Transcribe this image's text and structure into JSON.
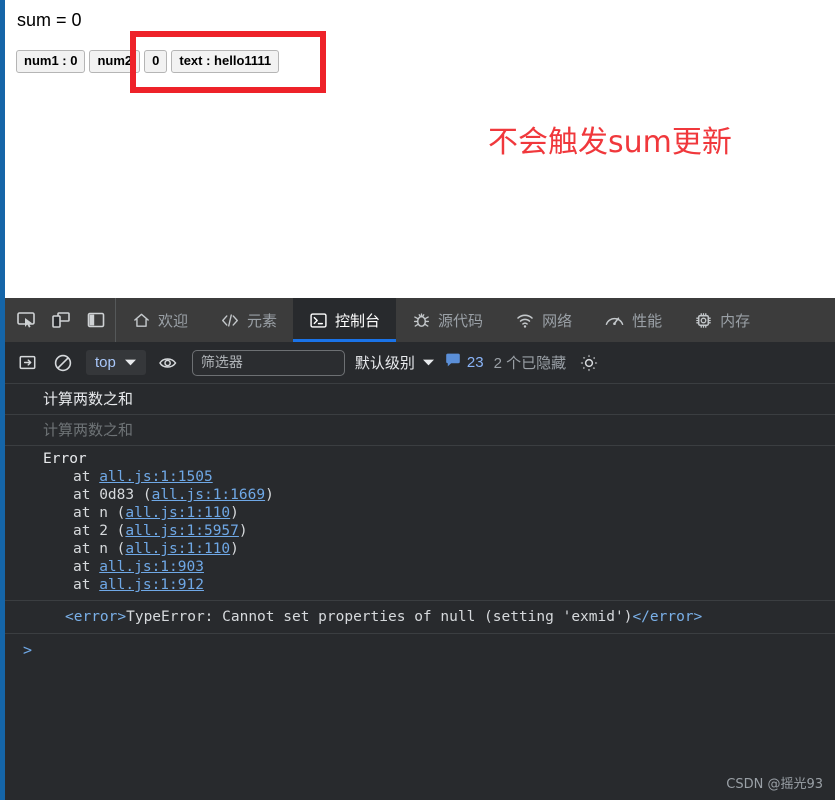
{
  "page": {
    "sum_text": "sum = 0",
    "buttons": [
      {
        "label": "num1 : 0",
        "name": "num1-button"
      },
      {
        "label": "num2",
        "name": "num2-button"
      },
      {
        "label": "0",
        "name": "num2-value-button"
      },
      {
        "label": "text : hello1111",
        "name": "text-button"
      }
    ],
    "annotation": "不会触发sum更新",
    "annotation_color": "#f0383c",
    "highlight_color": "#ee2229"
  },
  "devtools": {
    "tool_icons": [
      {
        "name": "inspect-element-icon"
      },
      {
        "name": "device-toolbar-icon"
      },
      {
        "name": "dock-side-icon"
      }
    ],
    "tabs": [
      {
        "label": "欢迎",
        "icon": "home-icon",
        "active": false
      },
      {
        "label": "元素",
        "icon": "code-brackets-icon",
        "active": false
      },
      {
        "label": "控制台",
        "icon": "console-terminal-icon",
        "active": true
      },
      {
        "label": "源代码",
        "icon": "bug-icon",
        "active": false
      },
      {
        "label": "网络",
        "icon": "network-wifi-icon",
        "active": false
      },
      {
        "label": "性能",
        "icon": "performance-gauge-icon",
        "active": false
      },
      {
        "label": "内存",
        "icon": "memory-chip-icon",
        "active": false
      }
    ],
    "active_tab_accent": "#1a73e8",
    "toolbar": {
      "sidebar_toggle": "console-sidebar-icon",
      "clear_label": "clear-console-icon",
      "context": "top",
      "eye_icon": "live-expression-icon",
      "filter_placeholder": "筛选器",
      "filter_value": "",
      "level_label": "默认级别",
      "message_count": "23",
      "hidden_label": "2 个已隐藏",
      "settings": "gear-icon"
    },
    "logs": [
      {
        "type": "text",
        "text": "计算两数之和",
        "dim": false
      },
      {
        "type": "text",
        "text": "计算两数之和",
        "dim": true
      }
    ],
    "trace": {
      "head": "Error",
      "lines": [
        {
          "prefix": "at ",
          "fn": "",
          "open": "",
          "link": "all.js:1:1505",
          "close": ""
        },
        {
          "prefix": "at ",
          "fn": "0d83 ",
          "open": "(",
          "link": "all.js:1:1669",
          "close": ")"
        },
        {
          "prefix": "at ",
          "fn": "n ",
          "open": "(",
          "link": "all.js:1:110",
          "close": ")"
        },
        {
          "prefix": "at ",
          "fn": "2 ",
          "open": "(",
          "link": "all.js:1:5957",
          "close": ")"
        },
        {
          "prefix": "at ",
          "fn": "n ",
          "open": "(",
          "link": "all.js:1:110",
          "close": ")"
        },
        {
          "prefix": "at ",
          "fn": "",
          "open": "",
          "link": "all.js:1:903",
          "close": ""
        },
        {
          "prefix": "at ",
          "fn": "",
          "open": "",
          "link": "all.js:1:912",
          "close": ""
        }
      ]
    },
    "error_line": {
      "open_tag": "<error>",
      "message": "TypeError: Cannot set properties of null (setting 'exmid')",
      "close_tag": "</error>"
    },
    "prompt_caret": ">",
    "watermark": "CSDN @摇光93"
  }
}
